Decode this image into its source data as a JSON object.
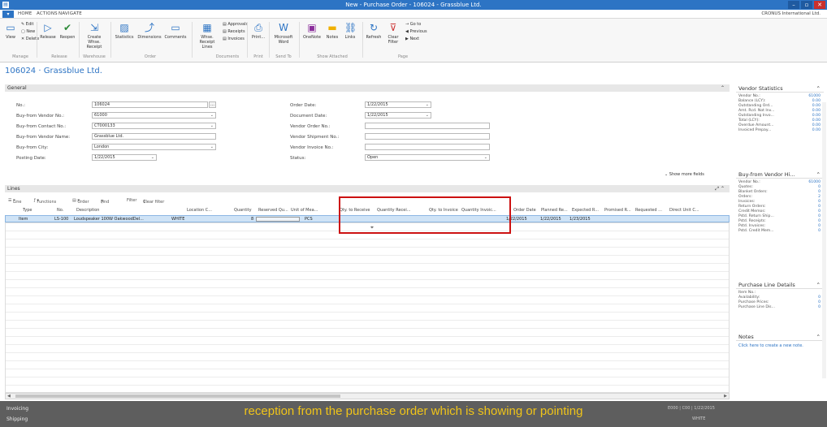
{
  "window": {
    "title": "New - Purchase Order - 106024 - Grassblue Ltd."
  },
  "menu": {
    "tabs": [
      "HOME",
      "ACTIONS",
      "NAVIGATE"
    ],
    "company": "CRONUS International Ltd."
  },
  "ribbon": {
    "view": "View",
    "edit": "Edit",
    "new": "New",
    "delete": "Delete",
    "release": "Release",
    "reopen": "Reopen",
    "create_whse_receipt": "Create Whse. Receipt",
    "statistics": "Statistics",
    "dimensions": "Dimensions",
    "comments": "Comments",
    "whse_receipt_lines": "Whse. Receipt Lines",
    "approvals": "Approvals",
    "receipts": "Receipts",
    "invoices": "Invoices",
    "print": "Print...",
    "microsoft_word": "Microsoft Word",
    "onenote": "OneNote",
    "notes": "Notes",
    "links": "Links",
    "refresh": "Refresh",
    "clear_filter": "Clear Filter",
    "go_to": "Go to",
    "previous": "Previous",
    "next": "Next",
    "groups": {
      "manage": "Manage",
      "release": "Release",
      "warehouse": "Warehouse",
      "order": "Order",
      "documents": "Documents",
      "print": "Print",
      "send_to": "Send To",
      "show_attached": "Show Attached",
      "page": "Page"
    }
  },
  "page": {
    "heading": "106024 · Grassblue Ltd."
  },
  "general": {
    "header": "General",
    "no_label": "No.:",
    "no_value": "106024",
    "vendor_no_label": "Buy-from Vendor No.:",
    "vendor_no_value": "61000",
    "contact_no_label": "Buy-from Contact No.:",
    "contact_no_value": "CT000133",
    "vendor_name_label": "Buy-from Vendor Name:",
    "vendor_name_value": "Grassblue Ltd.",
    "city_label": "Buy-from City:",
    "city_value": "London",
    "posting_date_label": "Posting Date:",
    "posting_date_value": "1/22/2015",
    "order_date_label": "Order Date:",
    "order_date_value": "1/22/2015",
    "document_date_label": "Document Date:",
    "document_date_value": "1/22/2015",
    "vendor_order_no_label": "Vendor Order No.:",
    "vendor_shipment_no_label": "Vendor Shipment No.:",
    "vendor_invoice_no_label": "Vendor Invoice No.:",
    "status_label": "Status:",
    "status_value": "Open",
    "show_more": "Show more fields"
  },
  "lines": {
    "header": "Lines",
    "toolbar": {
      "line": "Line",
      "functions": "Functions",
      "order": "Order",
      "find": "Find",
      "filter": "Filter",
      "clear_filter": "Clear filter"
    },
    "columns": [
      "Type",
      "No.",
      "Description",
      "Location C...",
      "Quantity",
      "Reserved Qu...",
      "Unit of Mea...",
      "Qty. to Receive",
      "Quantity Recei...",
      "Qty. to Invoice",
      "Quantity Invoic...",
      "Order Date",
      "Planned Re...",
      "Expected R...",
      "Promised R...",
      "Requested ...",
      "Direct Unit C..."
    ],
    "row": {
      "type": "Item",
      "no": "LS-100",
      "description": "Loudspeaker 100W OakwoodDel...",
      "location": "WHITE",
      "quantity": "8",
      "unit": "PCS",
      "order_date": "1/22/2015",
      "planned": "1/22/2015",
      "expected": "1/23/2015"
    }
  },
  "factboxes": {
    "vendor_statistics": {
      "title": "Vendor Statistics",
      "rows": [
        {
          "label": "Vendor No.:",
          "value": "61000"
        },
        {
          "label": "Balance (LCY):",
          "value": "0.00"
        },
        {
          "label": "Outstanding Ord...",
          "value": "0.00"
        },
        {
          "label": "Amt. Rcd. Not Inv...",
          "value": "0.00"
        },
        {
          "label": "Outstanding Invo...",
          "value": "0.00"
        },
        {
          "label": "Total (LCY):",
          "value": "0.00"
        },
        {
          "label": "Overdue Amount...",
          "value": "0.00"
        },
        {
          "label": "Invoiced Prepay...",
          "value": "0.00"
        }
      ]
    },
    "buy_from_vendor": {
      "title": "Buy-from Vendor Hi...",
      "rows": [
        {
          "label": "Vendor No.:",
          "value": "61000"
        },
        {
          "label": "Quotes:",
          "value": "0"
        },
        {
          "label": "Blanket Orders:",
          "value": "0"
        },
        {
          "label": "Orders:",
          "value": "2"
        },
        {
          "label": "Invoices:",
          "value": "0"
        },
        {
          "label": "Return Orders:",
          "value": "0"
        },
        {
          "label": "Credit Memos:",
          "value": "0"
        },
        {
          "label": "Pstd. Return Ship...",
          "value": "0"
        },
        {
          "label": "Pstd. Receipts:",
          "value": "0"
        },
        {
          "label": "Pstd. Invoices:",
          "value": "0"
        },
        {
          "label": "Pstd. Credit Mem...",
          "value": "0"
        }
      ]
    },
    "purchase_line_details": {
      "title": "Purchase Line Details",
      "rows": [
        {
          "label": "Item No.:",
          "value": ""
        },
        {
          "label": "Availability:",
          "value": "0"
        },
        {
          "label": "Purchase Prices:",
          "value": "0"
        },
        {
          "label": "Purchase Line Dis...",
          "value": "0"
        }
      ]
    },
    "notes": {
      "title": "Notes",
      "link": "Click here to create a new note."
    }
  },
  "footer": {
    "invoicing": "Invoicing",
    "shipping": "Shipping",
    "caption": "reception from the purchase order which is showing or pointing",
    "right1": "E000  |  C00  |  1/22/2015",
    "right2": "WHITE"
  }
}
